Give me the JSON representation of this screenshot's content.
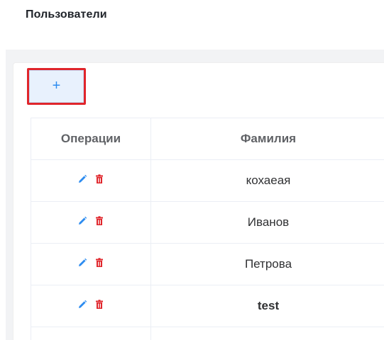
{
  "page": {
    "title": "Пользователи"
  },
  "toolbar": {
    "add_label": "+"
  },
  "table": {
    "columns": [
      "Операции",
      "Фамилия"
    ],
    "rows": [
      {
        "lastname": "кохаеая"
      },
      {
        "lastname": "Иванов"
      },
      {
        "lastname": "Петрова"
      },
      {
        "lastname": "test"
      }
    ]
  },
  "icons": {
    "edit": "pencil-icon",
    "delete": "trash-icon"
  },
  "colors": {
    "accent": "#2d8cf0",
    "danger": "#e0252b",
    "highlight": "#e0252b"
  }
}
